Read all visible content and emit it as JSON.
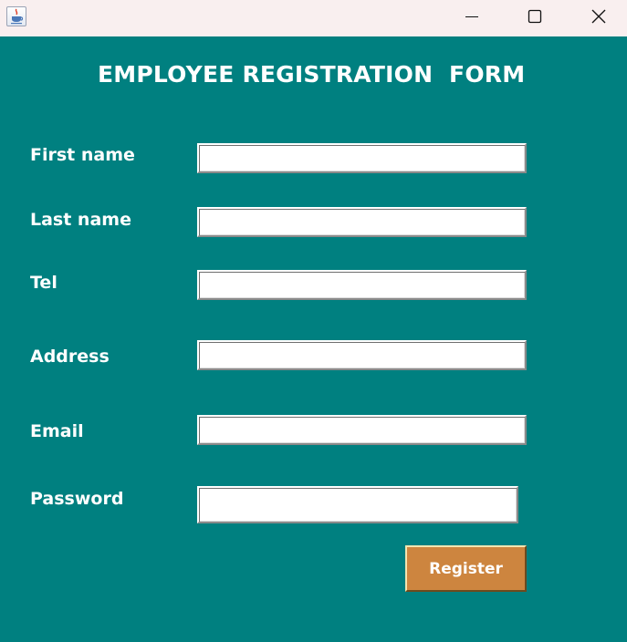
{
  "window": {
    "icon": "java-cup-icon",
    "controls": {
      "minimize": "minimize-icon",
      "maximize": "maximize-icon",
      "close": "close-icon"
    }
  },
  "form": {
    "title": "EMPLOYEE REGISTRATION  FORM",
    "fields": {
      "first_name": {
        "label": "First name",
        "value": ""
      },
      "last_name": {
        "label": "Last name",
        "value": ""
      },
      "tel": {
        "label": "Tel",
        "value": ""
      },
      "address": {
        "label": "Address",
        "value": ""
      },
      "email": {
        "label": "Email",
        "value": ""
      },
      "password": {
        "label": "Password",
        "value": ""
      }
    },
    "register_label": "Register"
  },
  "colors": {
    "background": "#008080",
    "titlebar": "#f9efef",
    "button": "#cd853f",
    "text": "#ffffff"
  }
}
